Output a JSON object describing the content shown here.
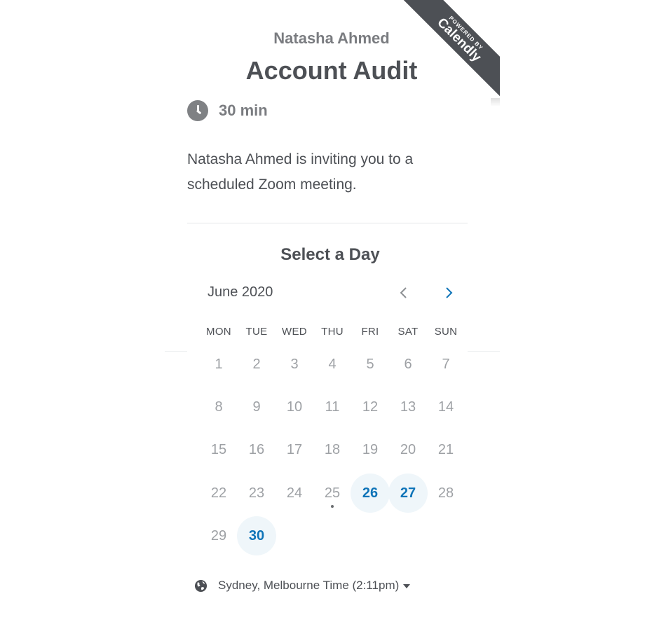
{
  "ribbon": {
    "powered_by": "POWERED BY",
    "brand": "Calendly"
  },
  "event": {
    "host": "Natasha Ahmed",
    "title": "Account Audit",
    "duration": "30 min",
    "description": "Natasha Ahmed is inviting you to a scheduled Zoom meeting."
  },
  "calendar": {
    "heading": "Select a Day",
    "month_label": "June 2020",
    "weekdays": [
      "MON",
      "TUE",
      "WED",
      "THU",
      "FRI",
      "SAT",
      "SUN"
    ],
    "days": [
      "1",
      "2",
      "3",
      "4",
      "5",
      "6",
      "7",
      "8",
      "9",
      "10",
      "11",
      "12",
      "13",
      "14",
      "15",
      "16",
      "17",
      "18",
      "19",
      "20",
      "21",
      "22",
      "23",
      "24",
      "25",
      "26",
      "27",
      "28",
      "29",
      "30"
    ],
    "available_days": [
      "26",
      "27",
      "30"
    ],
    "today": "25",
    "accent_color": "#0f74b8"
  },
  "timezone": {
    "label": "Sydney, Melbourne Time (2:11pm)"
  }
}
